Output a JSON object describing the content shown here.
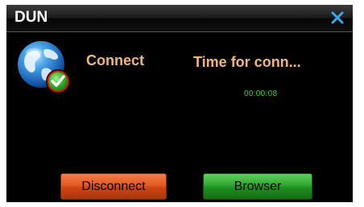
{
  "window": {
    "title": "DUN",
    "close_icon": "close-icon"
  },
  "status": {
    "icon": "globe-connected-icon",
    "connect_label": "Connect",
    "time_label": "Time for conn...",
    "time_value": "00:00:08"
  },
  "buttons": {
    "disconnect_label": "Disconnect",
    "browser_label": "Browser"
  },
  "colors": {
    "background": "#000000",
    "label_accent": "#f0b67e",
    "timer": "#3fcf3f",
    "close_icon": "#3aa7e8",
    "disconnect_button": "#e35a22",
    "browser_button": "#2aa02a"
  }
}
